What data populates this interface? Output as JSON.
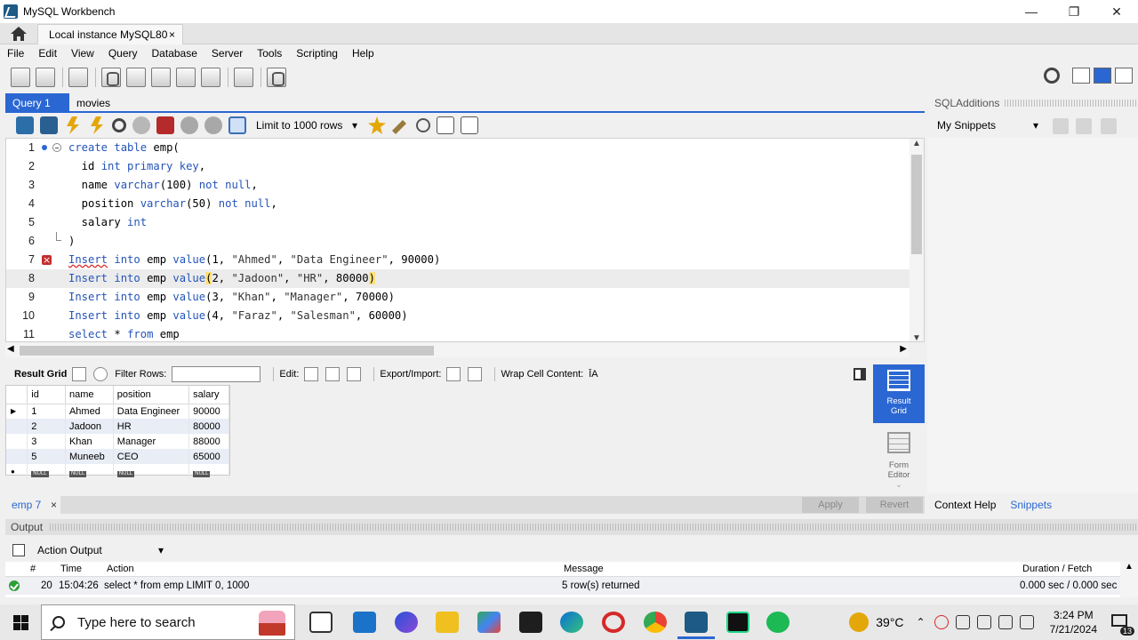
{
  "window": {
    "title": "MySQL Workbench",
    "minimize": "—",
    "restore": "❐",
    "close": "✕"
  },
  "instance_tab": {
    "label": "Local instance MySQL80",
    "close": "×"
  },
  "menu": [
    "File",
    "Edit",
    "View",
    "Query",
    "Database",
    "Server",
    "Tools",
    "Scripting",
    "Help"
  ],
  "query_tabs": [
    {
      "label": "Query 1",
      "active": true
    },
    {
      "label": "movies",
      "active": false
    }
  ],
  "sql_toolbar": {
    "limit_label": "Limit to 1000 rows",
    "dropdown_arrow": "▾"
  },
  "editor": {
    "lines": [
      {
        "num": "1",
        "parts": [
          [
            "kw",
            "create table "
          ],
          [
            "",
            "emp("
          ]
        ]
      },
      {
        "num": "2",
        "parts": [
          [
            "",
            "  id "
          ],
          [
            "kw",
            "int primary key"
          ],
          [
            "",
            ","
          ]
        ]
      },
      {
        "num": "3",
        "parts": [
          [
            "",
            "  name "
          ],
          [
            "kw",
            "varchar"
          ],
          [
            "",
            "(100) "
          ],
          [
            "kw",
            "not null"
          ],
          [
            "",
            ","
          ]
        ]
      },
      {
        "num": "4",
        "parts": [
          [
            "",
            "  position "
          ],
          [
            "kw",
            "varchar"
          ],
          [
            "",
            "(50) "
          ],
          [
            "kw",
            "not null"
          ],
          [
            "",
            ","
          ]
        ]
      },
      {
        "num": "5",
        "parts": [
          [
            "",
            "  salary "
          ],
          [
            "kw",
            "int"
          ]
        ]
      },
      {
        "num": "6",
        "parts": [
          [
            "",
            ")"
          ]
        ]
      },
      {
        "num": "7",
        "parts": [
          [
            "kw err",
            "Insert"
          ],
          [
            "kw",
            " into "
          ],
          [
            "",
            "emp "
          ],
          [
            "kw",
            "value"
          ],
          [
            "",
            "(1, "
          ],
          [
            "str",
            "\"Ahmed\""
          ],
          [
            "",
            ", "
          ],
          [
            "str",
            "\"Data Engineer\""
          ],
          [
            "",
            ", 90000)"
          ]
        ]
      },
      {
        "num": "8",
        "parts": [
          [
            "kw",
            "Insert into "
          ],
          [
            "",
            "emp "
          ],
          [
            "kw",
            "value"
          ],
          [
            "caret",
            "("
          ],
          [
            "",
            "2, "
          ],
          [
            "str",
            "\"Jadoon\""
          ],
          [
            "",
            ", "
          ],
          [
            "str",
            "\"HR\""
          ],
          [
            "",
            ", 80000"
          ],
          [
            "caret",
            ")"
          ]
        ]
      },
      {
        "num": "9",
        "parts": [
          [
            "kw",
            "Insert into "
          ],
          [
            "",
            "emp "
          ],
          [
            "kw",
            "value"
          ],
          [
            "",
            "(3, "
          ],
          [
            "str",
            "\"Khan\""
          ],
          [
            "",
            ", "
          ],
          [
            "str",
            "\"Manager\""
          ],
          [
            "",
            ", 70000)"
          ]
        ]
      },
      {
        "num": "10",
        "parts": [
          [
            "kw",
            "Insert into "
          ],
          [
            "",
            "emp "
          ],
          [
            "kw",
            "value"
          ],
          [
            "",
            "(4, "
          ],
          [
            "str",
            "\"Faraz\""
          ],
          [
            "",
            ", "
          ],
          [
            "str",
            "\"Salesman\""
          ],
          [
            "",
            ", 60000)"
          ]
        ]
      },
      {
        "num": "11",
        "parts": [
          [
            "kw",
            "select "
          ],
          [
            "",
            "* "
          ],
          [
            "kw",
            "from "
          ],
          [
            "",
            "emp"
          ]
        ]
      }
    ]
  },
  "result_toolbar": {
    "result_grid": "Result Grid",
    "filter_rows": "Filter Rows:",
    "edit": "Edit:",
    "export_import": "Export/Import:",
    "wrap": "Wrap Cell Content:",
    "wrap_icon": "ĪA"
  },
  "result_grid": {
    "columns": [
      "id",
      "name",
      "position",
      "salary"
    ],
    "rows": [
      [
        "1",
        "Ahmed",
        "Data Engineer",
        "90000"
      ],
      [
        "2",
        "Jadoon",
        "HR",
        "80000"
      ],
      [
        "3",
        "Khan",
        "Manager",
        "88000"
      ],
      [
        "5",
        "Muneeb",
        "CEO",
        "65000"
      ]
    ],
    "null_label": "NULL",
    "row_pointer": "▶",
    "new_row_marker": "●"
  },
  "side_buttons": {
    "result_grid_line1": "Result",
    "result_grid_line2": "Grid",
    "form_editor_line1": "Form",
    "form_editor_line2": "Editor"
  },
  "result_tabs": {
    "tab_label": "emp 7",
    "close": "×",
    "apply": "Apply",
    "revert": "Revert"
  },
  "sidebar": {
    "header": "SQLAdditions",
    "snippets_select": "My Snippets",
    "dropdown_arrow": "▾",
    "tabs": [
      "Context Help",
      "Snippets"
    ]
  },
  "output": {
    "header": "Output",
    "selector": "Action Output",
    "dropdown_arrow": "▾",
    "columns": [
      "#",
      "Time",
      "Action",
      "Message",
      "Duration / Fetch"
    ],
    "row": {
      "num": "20",
      "time": "15:04:26",
      "action": "select * from emp LIMIT 0, 1000",
      "message": "5 row(s) returned",
      "duration": "0.000 sec / 0.000 sec"
    }
  },
  "taskbar": {
    "search_placeholder": "Type here to search",
    "temperature": "39°C",
    "time": "3:24 PM",
    "date": "7/21/2024",
    "notifications": "13"
  },
  "colors": {
    "accent": "#2b67d2",
    "keyword": "#2454b8",
    "error": "#c42d2d",
    "ok": "#2f9e3a"
  }
}
